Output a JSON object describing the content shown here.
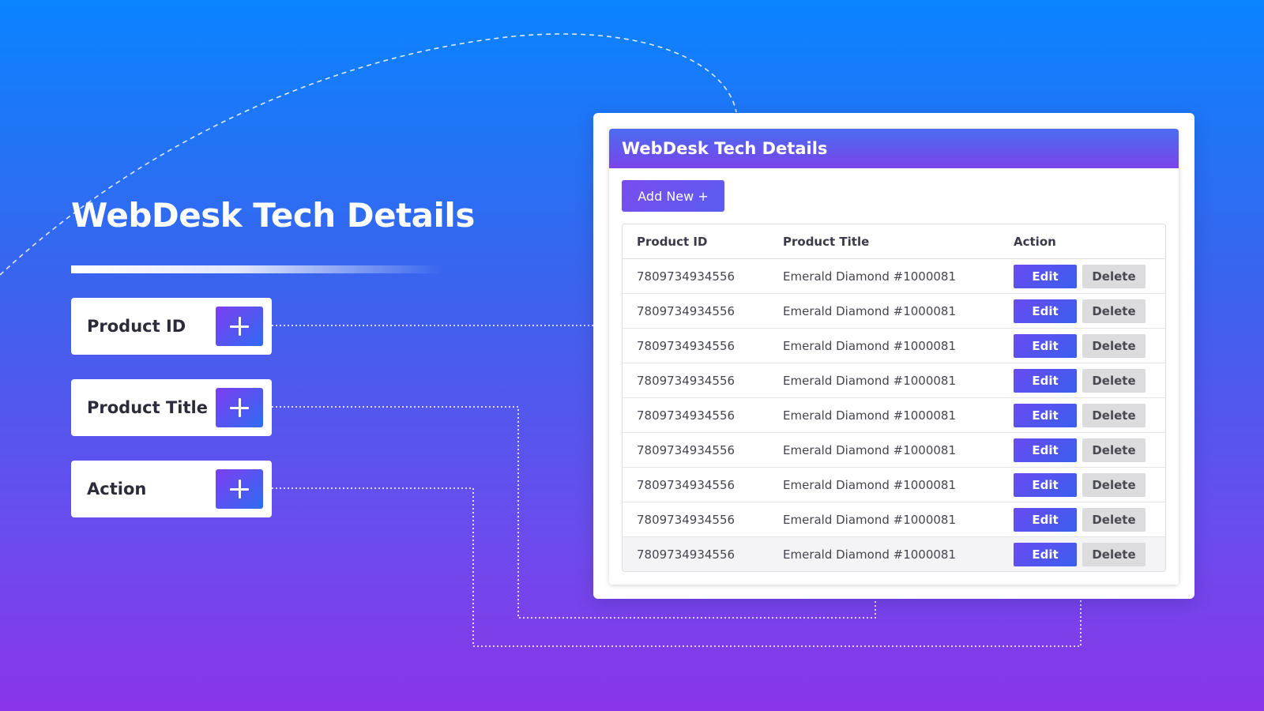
{
  "hero": {
    "title": "WebDesk Tech Details"
  },
  "fields": [
    {
      "label": "Product ID",
      "icon": "plus-icon"
    },
    {
      "label": "Product Title",
      "icon": "plus-icon"
    },
    {
      "label": "Action",
      "icon": "plus-icon"
    }
  ],
  "panel": {
    "title": "WebDesk Tech Details",
    "add_new_label": "Add New +",
    "columns": [
      "Product ID",
      "Product Title",
      "Action"
    ],
    "rows": [
      {
        "id": "7809734934556",
        "title": "Emerald Diamond #1000081",
        "edit": "Edit",
        "delete": "Delete"
      },
      {
        "id": "7809734934556",
        "title": "Emerald Diamond #1000081",
        "edit": "Edit",
        "delete": "Delete"
      },
      {
        "id": "7809734934556",
        "title": "Emerald Diamond #1000081",
        "edit": "Edit",
        "delete": "Delete"
      },
      {
        "id": "7809734934556",
        "title": "Emerald Diamond #1000081",
        "edit": "Edit",
        "delete": "Delete"
      },
      {
        "id": "7809734934556",
        "title": "Emerald Diamond #1000081",
        "edit": "Edit",
        "delete": "Delete"
      },
      {
        "id": "7809734934556",
        "title": "Emerald Diamond #1000081",
        "edit": "Edit",
        "delete": "Delete"
      },
      {
        "id": "7809734934556",
        "title": "Emerald Diamond #1000081",
        "edit": "Edit",
        "delete": "Delete"
      },
      {
        "id": "7809734934556",
        "title": "Emerald Diamond #1000081",
        "edit": "Edit",
        "delete": "Delete"
      },
      {
        "id": "7809734934556",
        "title": "Emerald Diamond #1000081",
        "edit": "Edit",
        "delete": "Delete"
      }
    ]
  },
  "colors": {
    "background_top": "#0a84ff",
    "background_bottom": "#8a35e8",
    "accent": "#5b5df0",
    "delete_button": "#dcdcdf"
  }
}
